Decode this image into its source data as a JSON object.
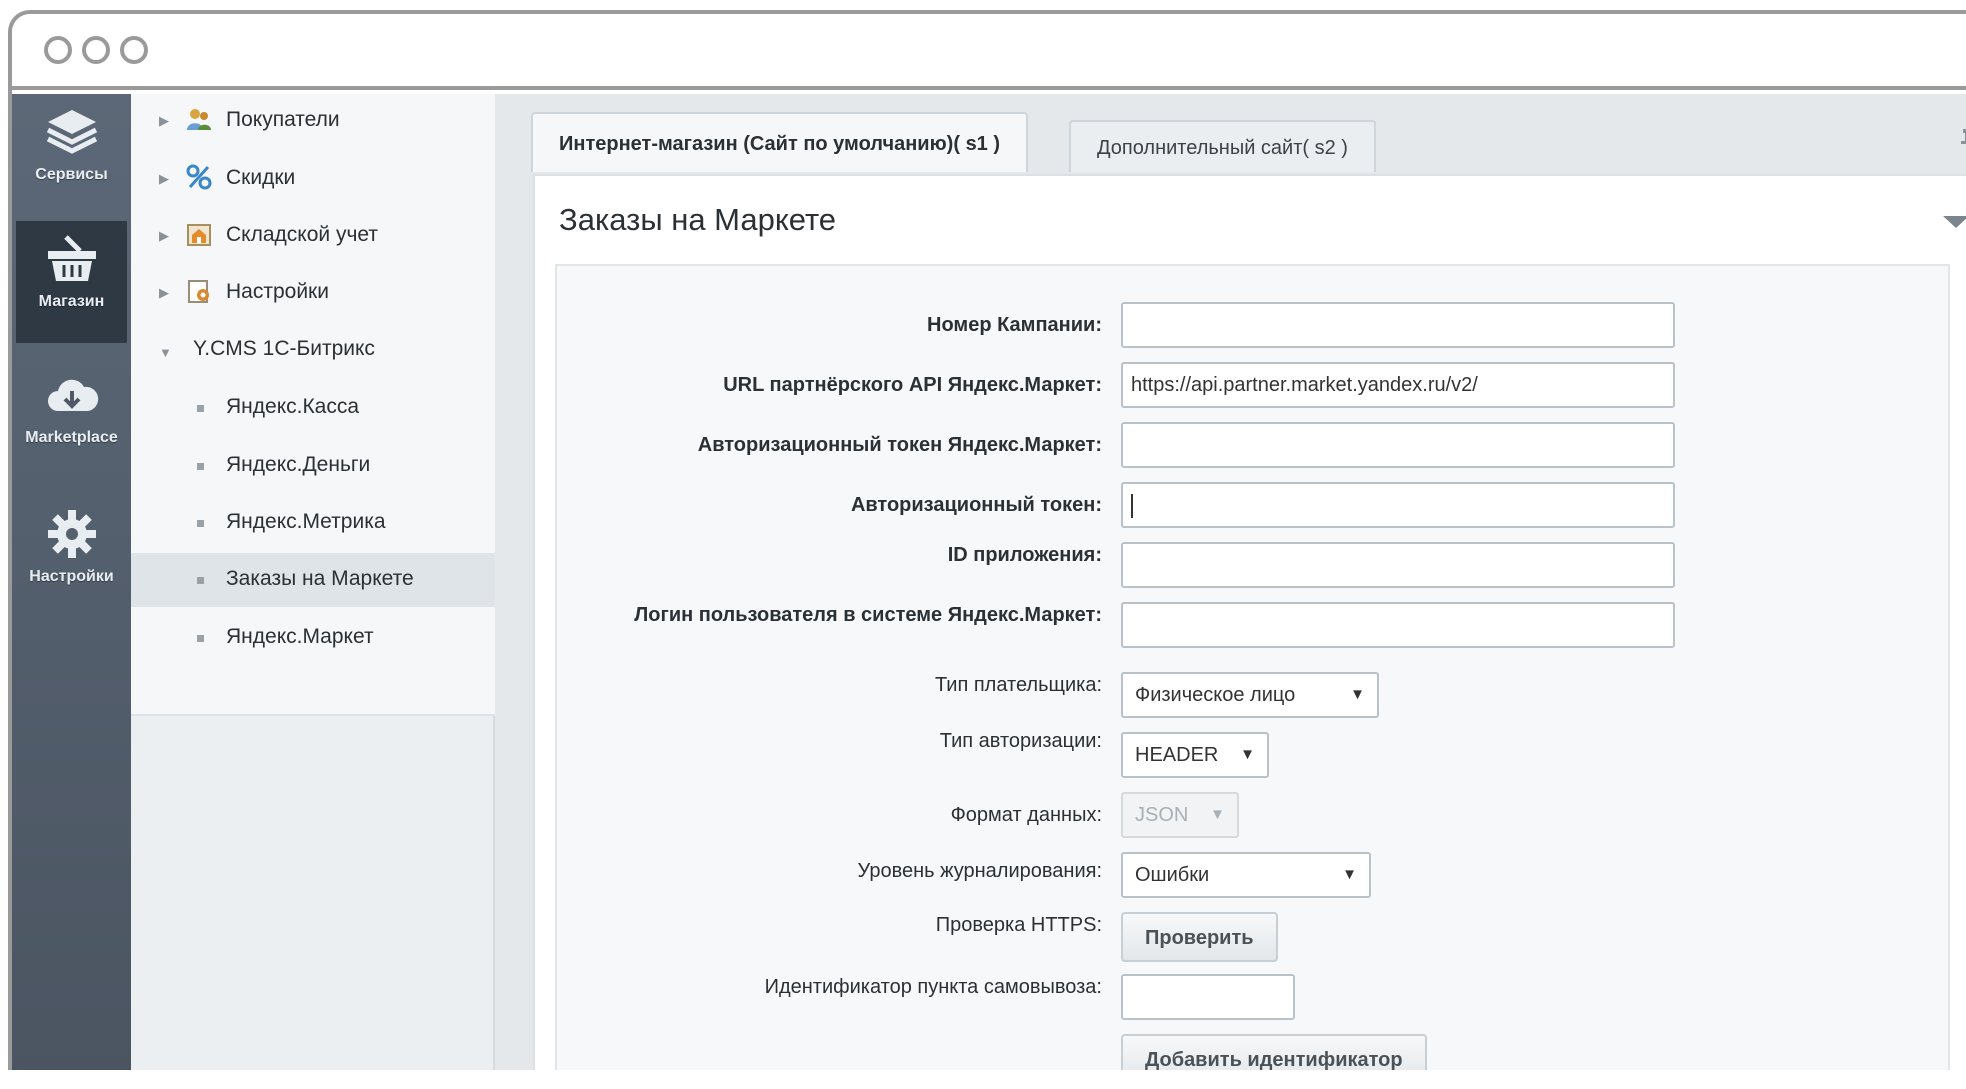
{
  "rail": {
    "items": [
      {
        "label": "Сервисы",
        "icon": "layers-icon"
      },
      {
        "label": "Магазин",
        "icon": "basket-icon"
      },
      {
        "label": "Marketplace",
        "icon": "cloud-download-icon"
      },
      {
        "label": "Настройки",
        "icon": "gear-icon"
      }
    ]
  },
  "tree": {
    "items": [
      {
        "label": "Покупатели",
        "icon": "users-icon"
      },
      {
        "label": "Скидки",
        "icon": "percent-icon"
      },
      {
        "label": "Складской учет",
        "icon": "warehouse-icon"
      },
      {
        "label": "Настройки",
        "icon": "settings-icon"
      },
      {
        "label": "Y.CMS 1С-Битрикс"
      },
      {
        "label": "Яндекс.Касса"
      },
      {
        "label": "Яндекс.Деньги"
      },
      {
        "label": "Яндекс.Метрика"
      },
      {
        "label": "Заказы на Маркете"
      },
      {
        "label": "Яндекс.Маркет"
      }
    ]
  },
  "tabs": [
    {
      "label": "Интернет-магазин (Сайт по умолчанию)( s1 )"
    },
    {
      "label": "Дополнительный сайт( s2 )"
    }
  ],
  "panel": {
    "title": "Заказы на Маркете"
  },
  "form": {
    "campaign_label": "Номер Кампании:",
    "campaign_value": "",
    "api_url_label": "URL партнёрского API Яндекс.Маркет:",
    "api_url_value": "https://api.partner.market.yandex.ru/v2/",
    "market_token_label": "Авторизационный токен Яндекс.Маркет:",
    "market_token_value": "",
    "auth_token_label": "Авторизационный токен:",
    "auth_token_value": "",
    "app_id_label": "ID приложения:",
    "app_id_value": "",
    "login_label": "Логин пользователя в системе Яндекс.Маркет:",
    "login_value": "",
    "payer_type_label": "Тип плательщика:",
    "payer_type_value": "Физическое лицо",
    "auth_type_label": "Тип авторизации:",
    "auth_type_value": "HEADER",
    "data_format_label": "Формат данных:",
    "data_format_value": "JSON",
    "log_level_label": "Уровень журналирования:",
    "log_level_value": "Ошибки",
    "https_check_label": "Проверка HTTPS:",
    "https_check_button": "Проверить",
    "pickup_id_label": "Идентификатор пункта самовывоза:",
    "pickup_id_value": "",
    "add_id_button": "Добавить идентификатор"
  }
}
